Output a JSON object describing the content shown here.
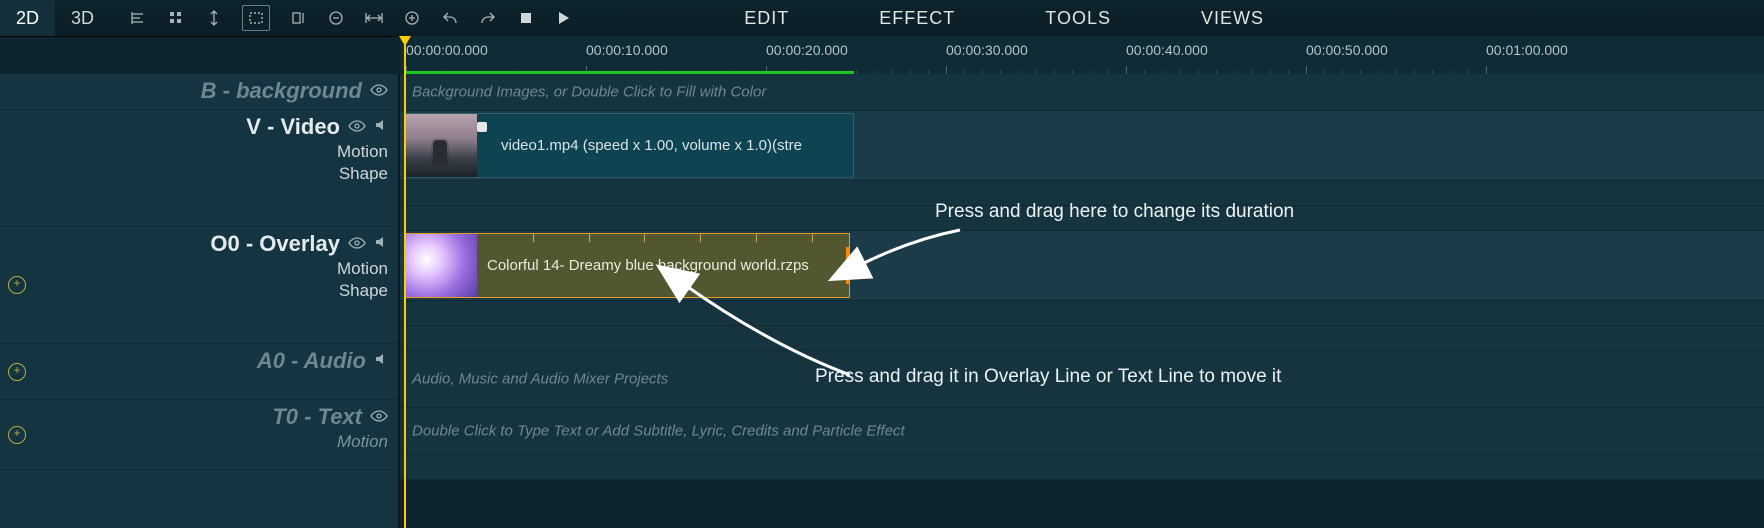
{
  "topbar": {
    "view2d": "2D",
    "view3d": "3D",
    "menus": {
      "edit": "EDIT",
      "effect": "EFFECT",
      "tools": "TOOLS",
      "views": "VIEWS"
    }
  },
  "ruler": {
    "times": [
      "00:00:00.000",
      "00:00:10.000",
      "00:00:20.000",
      "00:00:30.000",
      "00:00:40.000",
      "00:00:50.000",
      "00:01:00.000"
    ]
  },
  "tracks": {
    "background": {
      "title": "B - background",
      "placeholder": "Background Images, or Double Click to Fill with Color"
    },
    "video": {
      "title": "V - Video",
      "sub1": "Motion",
      "sub2": "Shape",
      "clip_label": "video1.mp4  (speed x 1.00, volume x 1.0)(stre"
    },
    "overlay": {
      "title": "O0 - Overlay",
      "sub1": "Motion",
      "sub2": "Shape",
      "clip_label": "Colorful 14- Dreamy blue background world.rzps"
    },
    "audio": {
      "title": "A0 - Audio",
      "placeholder": "Audio, Music and Audio Mixer Projects"
    },
    "text": {
      "title": "T0 - Text",
      "sub1": "Motion",
      "placeholder": "Double Click to Type Text or Add Subtitle, Lyric, Credits and Particle Effect"
    }
  },
  "annotations": {
    "duration": "Press and drag here to change its duration",
    "move": "Press and drag it in Overlay Line or Text Line to move it"
  }
}
